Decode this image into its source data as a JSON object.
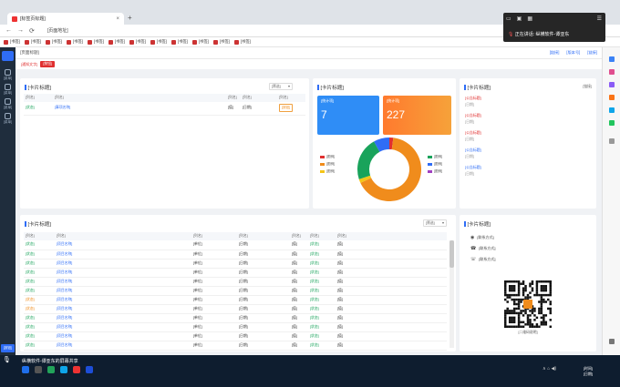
{
  "browser": {
    "tab_title": "[标签页标题]",
    "new_tab": "+",
    "url": "[页面地址]",
    "bookmarks": [
      "[书签]",
      "[书签]",
      "[书签]",
      "[书签]",
      "[书签]",
      "[书签]",
      "[书签]",
      "[书签]",
      "[书签]",
      "[书签]",
      "[书签]",
      "[书签]"
    ]
  },
  "meeting": {
    "status_label": "正在讲话:",
    "speaker": "纵横软件-谭亚东"
  },
  "app": {
    "logo": "",
    "breadcrumb": "[页面标题]",
    "header_links": [
      "[链接]",
      "[版本号]",
      "[链接]"
    ],
    "nav": [
      "[菜单]",
      "[菜单]",
      "[菜单]",
      "[菜单]"
    ],
    "nav_bottom": "[按钮]",
    "notice": "[通知文字]",
    "notice_btn": "[按钮]"
  },
  "todo": {
    "title": "[卡片标题]",
    "filter": "[筛选]",
    "columns": [
      "[列名]",
      "[列名]",
      "[列名]",
      "[列名]",
      "[列名]"
    ],
    "rows": [
      {
        "type": "[状态]",
        "name": "[事项名称]",
        "time_label": "[值]",
        "date": "[日期]",
        "action": "[按钮]"
      }
    ]
  },
  "mine": {
    "title": "[卡片标题]",
    "stat1_label": "[统计项]",
    "stat1_value": "7",
    "stat1_unit": "",
    "stat2_label": "[统计项]",
    "stat2_value": "227",
    "stat2_unit": "",
    "legend": [
      {
        "label": "[图例]",
        "color": "#e03030"
      },
      {
        "label": "[图例]",
        "color": "#f08c1c"
      },
      {
        "label": "[图例]",
        "color": "#f5c518"
      },
      {
        "label": "[图例]",
        "color": "#19a35b"
      },
      {
        "label": "[图例]",
        "color": "#2f6df6"
      },
      {
        "label": "[图例]",
        "color": "#a040c0"
      }
    ]
  },
  "chart_data": {
    "type": "pie",
    "title": "",
    "categories": [
      "[图例]",
      "[图例]",
      "[图例]",
      "[图例]",
      "[图例]",
      "[图例]"
    ],
    "values": [
      2,
      66,
      2,
      22,
      8,
      0
    ],
    "colors": [
      "#e03030",
      "#f08c1c",
      "#f5c518",
      "#19a35b",
      "#2f6df6",
      "#a040c0"
    ]
  },
  "announce": {
    "title": "[卡片标题]",
    "more": "[链接]",
    "items": [
      {
        "title": "[公告标题]",
        "date": "[日期]",
        "color": "red"
      },
      {
        "title": "[公告标题]",
        "date": "[日期]",
        "color": "red"
      },
      {
        "title": "[公告标题]",
        "date": "[日期]",
        "color": "red"
      },
      {
        "title": "[公告标题]",
        "date": "[日期]",
        "color": "blue"
      },
      {
        "title": "[公告标题]",
        "date": "[日期]",
        "color": "blue"
      }
    ]
  },
  "projects": {
    "title": "[卡片标题]",
    "filter": "[筛选]",
    "columns": [
      "[列名]",
      "[列名]",
      "[列名]",
      "[列名]",
      "[列名]",
      "[列名]",
      "[列名]"
    ],
    "rows": [
      {
        "status": "[状态]",
        "s_color": "green",
        "name": "[项目名称]",
        "org": "[单位]",
        "date": "[日期]",
        "role": "[值]",
        "state": "[状态]",
        "st_color": "green",
        "result": "[值]"
      },
      {
        "status": "[状态]",
        "s_color": "green",
        "name": "[项目名称]",
        "org": "[单位]",
        "date": "[日期]",
        "role": "[值]",
        "state": "[状态]",
        "st_color": "green",
        "result": "[值]"
      },
      {
        "status": "[状态]",
        "s_color": "green",
        "name": "[项目名称]",
        "org": "[单位]",
        "date": "[日期]",
        "role": "[值]",
        "state": "[状态]",
        "st_color": "green",
        "result": "[值]"
      },
      {
        "status": "[状态]",
        "s_color": "green",
        "name": "[项目名称]",
        "org": "[单位]",
        "date": "[日期]",
        "role": "[值]",
        "state": "[状态]",
        "st_color": "green",
        "result": "[值]"
      },
      {
        "status": "[状态]",
        "s_color": "green",
        "name": "[项目名称]",
        "org": "[单位]",
        "date": "[日期]",
        "role": "[值]",
        "state": "[状态]",
        "st_color": "green",
        "result": "[值]"
      },
      {
        "status": "[状态]",
        "s_color": "green",
        "name": "[项目名称]",
        "org": "[单位]",
        "date": "[日期]",
        "role": "[值]",
        "state": "[状态]",
        "st_color": "green",
        "result": "[值]"
      },
      {
        "status": "[状态]",
        "s_color": "orange",
        "name": "[项目名称]",
        "org": "[单位]",
        "date": "[日期]",
        "role": "[值]",
        "state": "[状态]",
        "st_color": "green",
        "result": "[值]"
      },
      {
        "status": "[状态]",
        "s_color": "orange",
        "name": "[项目名称]",
        "org": "[单位]",
        "date": "[日期]",
        "role": "[值]",
        "state": "[状态]",
        "st_color": "green",
        "result": "[值]"
      },
      {
        "status": "[状态]",
        "s_color": "green",
        "name": "[项目名称]",
        "org": "[单位]",
        "date": "[日期]",
        "role": "[值]",
        "state": "[状态]",
        "st_color": "green",
        "result": "[值]"
      },
      {
        "status": "[状态]",
        "s_color": "green",
        "name": "[项目名称]",
        "org": "[单位]",
        "date": "[日期]",
        "role": "[值]",
        "state": "[状态]",
        "st_color": "green",
        "result": "[值]"
      },
      {
        "status": "[状态]",
        "s_color": "green",
        "name": "[项目名称]",
        "org": "[单位]",
        "date": "[日期]",
        "role": "[值]",
        "state": "[状态]",
        "st_color": "green",
        "result": "[值]"
      },
      {
        "status": "[状态]",
        "s_color": "green",
        "name": "[项目名称]",
        "org": "[单位]",
        "date": "[日期]",
        "role": "[值]",
        "state": "[状态]",
        "st_color": "green",
        "result": "[值]"
      }
    ]
  },
  "support": {
    "title": "[卡片标题]",
    "lines": [
      "[联系方式]",
      "[联系方式]",
      "[联系方式]"
    ],
    "qr_caption": "[二维码说明]"
  },
  "taskbar": {
    "share_text": "纵横软件-谭亚东的屏幕共享",
    "time": "[时间]",
    "date": "[日期]"
  }
}
